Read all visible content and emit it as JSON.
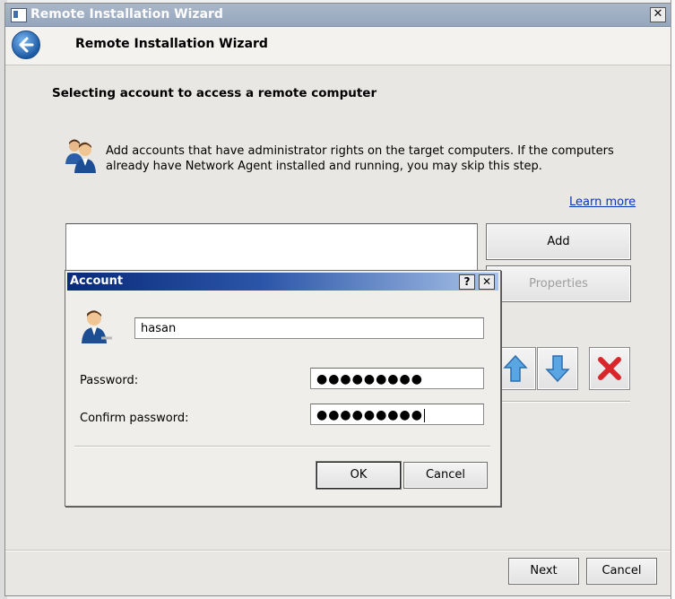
{
  "wizard": {
    "window_title": "Remote Installation Wizard",
    "header_title": "Remote Installation Wizard",
    "heading": "Selecting account to access a remote computer",
    "description": "Add accounts that have administrator rights on the target computers. If the computers already have Network Agent installed and running, you may skip this step.",
    "learn_more": "Learn more",
    "buttons": {
      "add": "Add",
      "properties": "Properties",
      "next": "Next",
      "cancel": "Cancel"
    },
    "icons": [
      "back-arrow-icon",
      "users-icon",
      "move-up-icon",
      "move-down-icon",
      "delete-icon"
    ]
  },
  "account_dialog": {
    "title": "Account",
    "title_buttons": {
      "help": "?",
      "close": "✕"
    },
    "username": "hasan",
    "password_label": "Password:",
    "password_value": "●●●●●●●●●",
    "confirm_label": "Confirm password:",
    "confirm_value": "●●●●●●●●●",
    "buttons": {
      "ok": "OK",
      "cancel": "Cancel"
    }
  },
  "colors": {
    "accent": "#1c5aa5",
    "dialog_title": "#0a2a7a",
    "link": "#0a35b5",
    "delete": "#d9262b"
  }
}
